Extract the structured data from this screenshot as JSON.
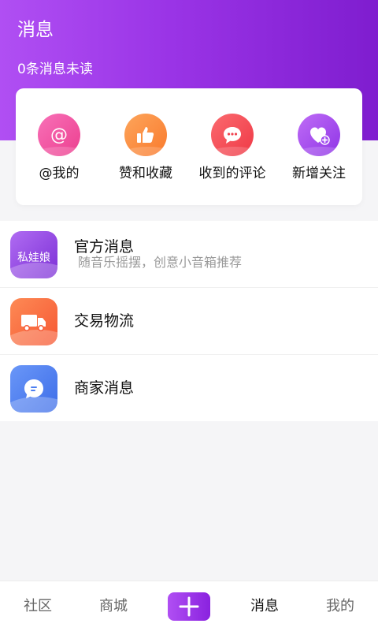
{
  "header": {
    "title": "消息",
    "unread_text": "0条消息未读"
  },
  "quick_actions": [
    {
      "label": "@我的",
      "icon": "at-icon",
      "color": "#f34f9d"
    },
    {
      "label": "赞和收藏",
      "icon": "thumbs-up-icon",
      "color": "#fb8a3c"
    },
    {
      "label": "收到的评论",
      "icon": "comment-icon",
      "color": "#f44a55"
    },
    {
      "label": "新增关注",
      "icon": "heart-plus-icon",
      "color": "#a24cf0"
    }
  ],
  "messages": [
    {
      "title": "官方消息",
      "subtitle": "随音乐摇摆，创意小音箱推荐",
      "avatar_text": "私娃娘",
      "icon": "official-avatar",
      "color": "#9b45e8"
    },
    {
      "title": "交易物流",
      "subtitle": "",
      "icon": "truck-icon",
      "color": "#fa6f3f"
    },
    {
      "title": "商家消息",
      "subtitle": "",
      "icon": "chat-bubble-icon",
      "color": "#4b7ef1"
    }
  ],
  "bottom_nav": {
    "community": "社区",
    "mall": "商城",
    "plus_icon": "plus-icon",
    "messages": "消息",
    "mine": "我的"
  },
  "colors": {
    "header_start": "#b04ff3",
    "header_end": "#7f1dcf",
    "page_bg": "#f5f5f7"
  }
}
